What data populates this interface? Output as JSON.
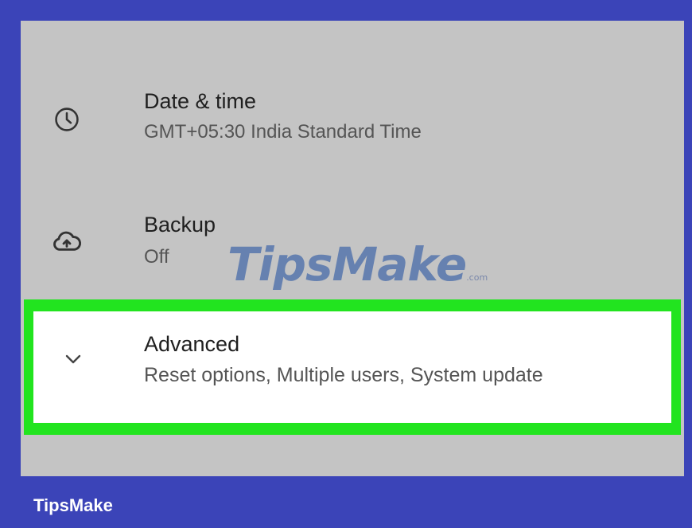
{
  "settings": {
    "items": [
      {
        "icon": "clock-icon",
        "title": "Date & time",
        "subtitle": "GMT+05:30 India Standard Time"
      },
      {
        "icon": "cloud-upload-icon",
        "title": "Backup",
        "subtitle": "Off"
      },
      {
        "icon": "chevron-down-icon",
        "title": "Advanced",
        "subtitle": "Reset options, Multiple users, System update"
      }
    ]
  },
  "watermark": {
    "text": "TipsMake",
    "suffix": ".com"
  },
  "footer": {
    "brand": "TipsMake"
  },
  "colors": {
    "frame": "#3b44b8",
    "screen": "#c4c4c4",
    "highlight": "#22e41f",
    "card": "#ffffff"
  }
}
